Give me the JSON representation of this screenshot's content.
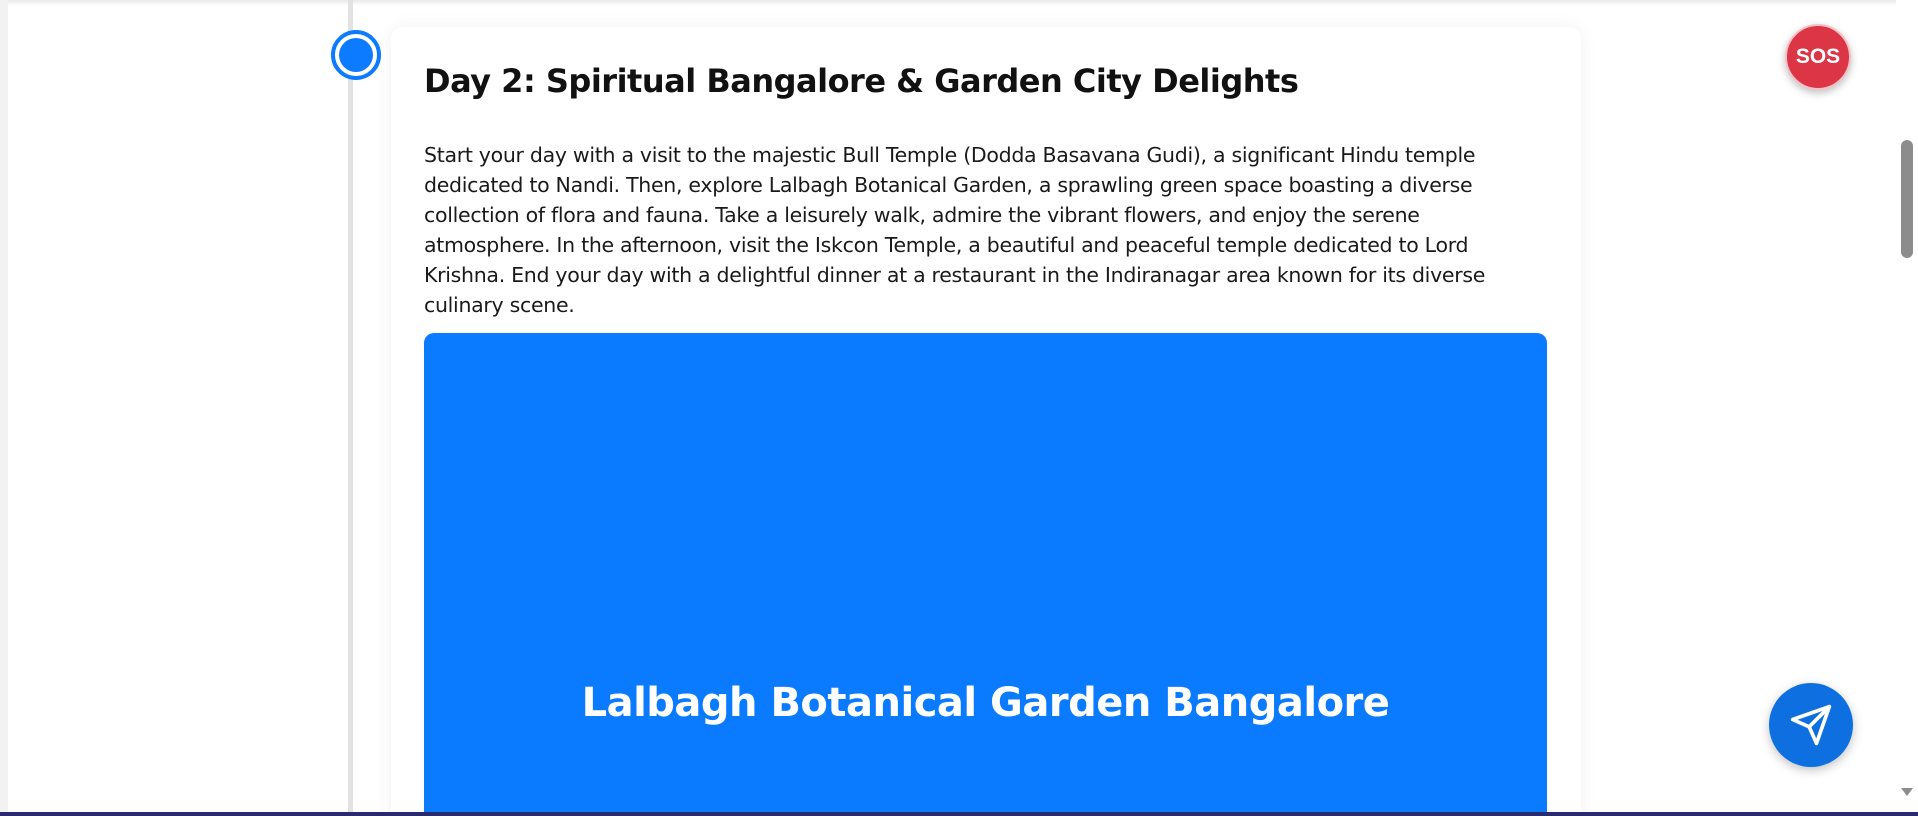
{
  "itinerary": {
    "day_title": "Day 2: Spiritual Bangalore & Garden City Delights",
    "day_description": "Start your day with a visit to the majestic Bull Temple (Dodda Basavana Gudi), a significant Hindu temple dedicated to Nandi. Then, explore Lalbagh Botanical Garden, a sprawling green space boasting a diverse collection of flora and fauna. Take a leisurely walk, admire the vibrant flowers, and enjoy the serene atmosphere. In the afternoon, visit the Iskcon Temple, a beautiful and peaceful temple dedicated to Lord Krishna. End your day with a delightful dinner at a restaurant in the Indiranagar area known for its diverse culinary scene.",
    "place_image_title": "Lalbagh Botanical Garden Bangalore"
  },
  "actions": {
    "sos_label": "SOS",
    "send_icon": "send-icon"
  },
  "colors": {
    "accent": "#0d7bff",
    "image_placeholder": "#0a7aff",
    "sos": "#dc3545",
    "send_button": "#0d6fe0"
  }
}
